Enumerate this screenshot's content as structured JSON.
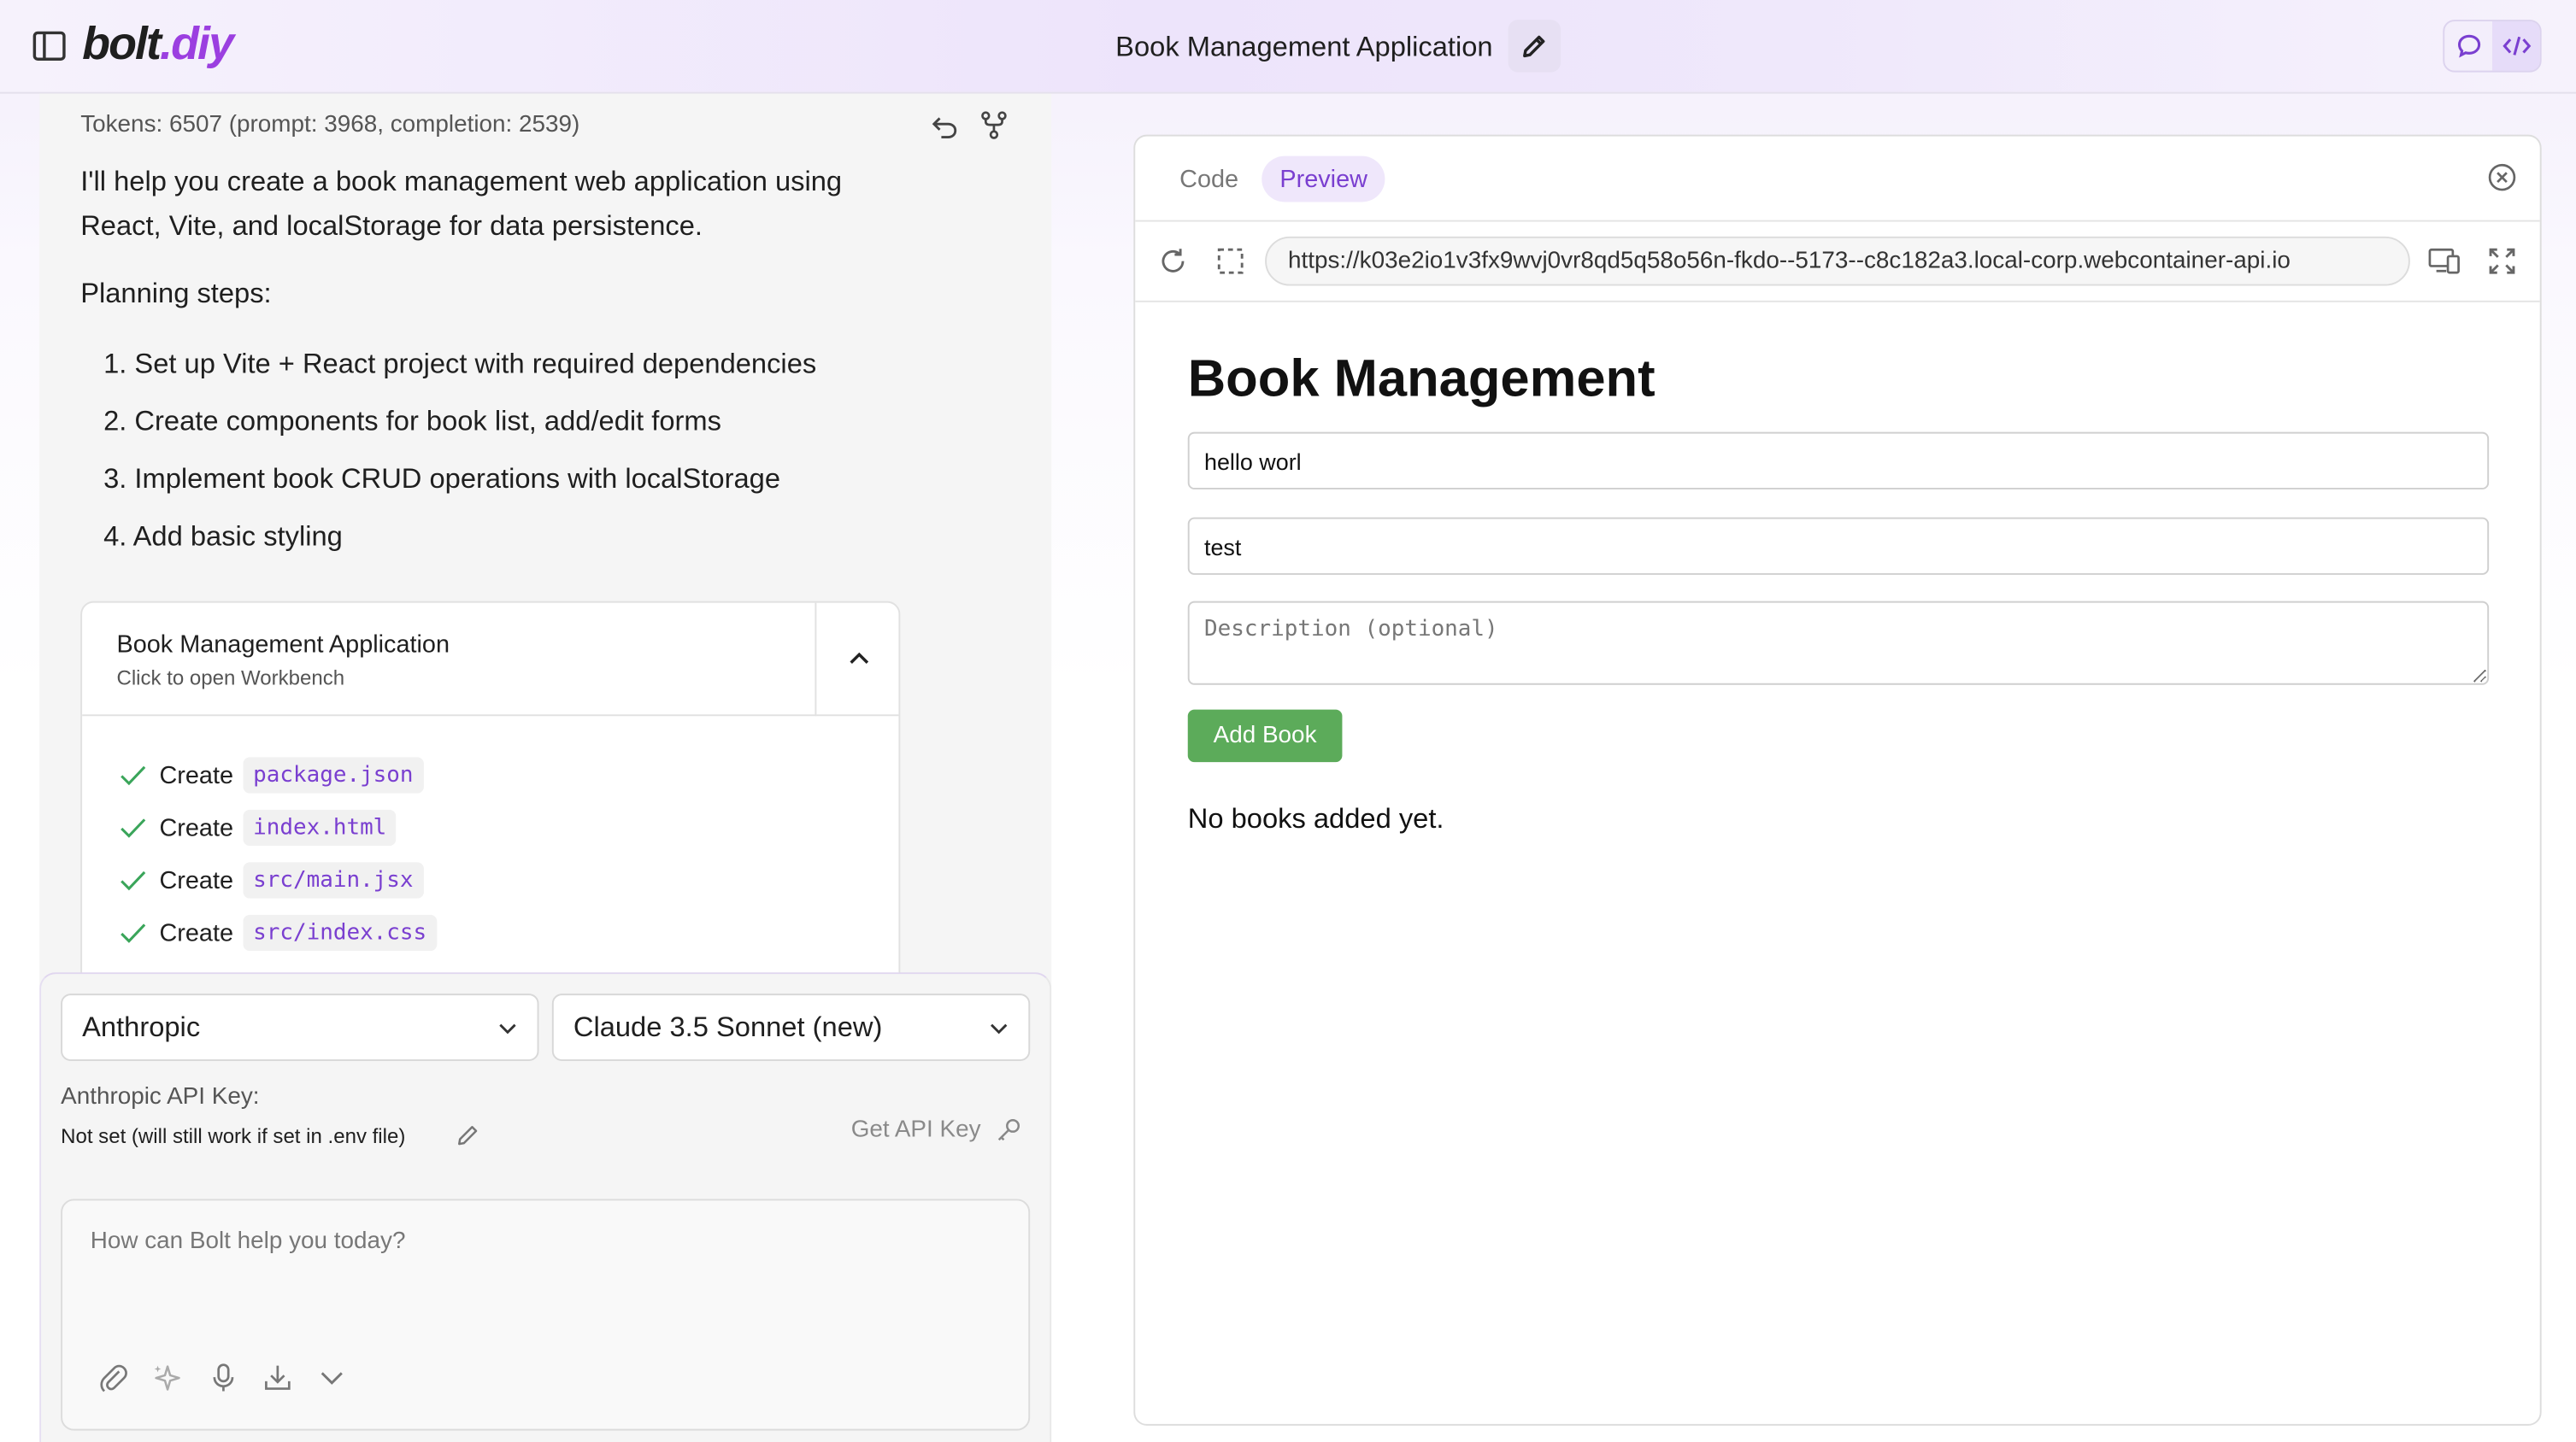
{
  "header": {
    "logo_main": "bolt",
    "logo_accent": ".diy",
    "title": "Book Management Application",
    "accent_color": "#9b3fe0"
  },
  "chat": {
    "tokens": "Tokens: 6507 (prompt: 3968, completion: 2539)",
    "message": "I'll help you create a book management web application using React, Vite, and localStorage for data persistence.",
    "plan_heading": "Planning steps:",
    "plan_steps": [
      "1. Set up Vite + React project with required dependencies",
      "2. Create components for book list, add/edit forms",
      "3. Implement book CRUD operations with localStorage",
      "4. Add basic styling"
    ],
    "artifact": {
      "title": "Book Management Application",
      "subtitle": "Click to open Workbench",
      "actions": [
        {
          "verb": "Create",
          "file": "package.json"
        },
        {
          "verb": "Create",
          "file": "index.html"
        },
        {
          "verb": "Create",
          "file": "src/main.jsx"
        },
        {
          "verb": "Create",
          "file": "src/index.css"
        }
      ]
    }
  },
  "input": {
    "provider": "Anthropic",
    "model": "Claude 3.5 Sonnet (new)",
    "api_key_label": "Anthropic API Key:",
    "api_key_status": "Not set (will still work if set in .env file)",
    "get_api_key": "Get API Key",
    "placeholder": "How can Bolt help you today?"
  },
  "workbench": {
    "tabs": [
      "Code",
      "Preview"
    ],
    "active_tab": "Preview",
    "url": "https://k03e2io1v3fx9wvj0vr8qd5q58o56n-fkdo--5173--c8c182a3.local-corp.webcontainer-api.io",
    "preview": {
      "heading": "Book Management",
      "title_value": "hello worl",
      "author_value": "test",
      "description_placeholder": "Description (optional)",
      "add_button": "Add Book",
      "empty_message": "No books added yet."
    }
  }
}
